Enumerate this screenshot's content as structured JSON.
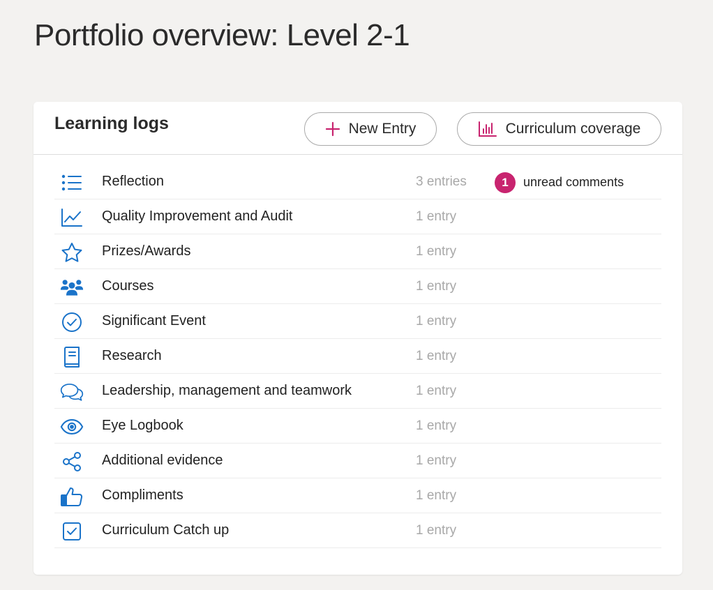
{
  "page": {
    "title": "Portfolio overview: Level 2-1"
  },
  "card": {
    "title": "Learning logs",
    "new_entry_label": "New Entry",
    "coverage_label": "Curriculum coverage"
  },
  "colors": {
    "icon_blue": "#1a73c9",
    "accent_magenta": "#c8246f",
    "muted_text": "#a8a8a8"
  },
  "logs": [
    {
      "name": "Reflection",
      "count": "3 entries",
      "icon": "list-icon",
      "badge": "1",
      "badge_label": "unread comments"
    },
    {
      "name": "Quality Improvement and Audit",
      "count": "1 entry",
      "icon": "line-chart-icon"
    },
    {
      "name": "Prizes/Awards",
      "count": "1 entry",
      "icon": "star-icon"
    },
    {
      "name": "Courses",
      "count": "1 entry",
      "icon": "people-icon"
    },
    {
      "name": "Significant Event",
      "count": "1 entry",
      "icon": "check-circle-icon"
    },
    {
      "name": "Research",
      "count": "1 entry",
      "icon": "book-icon"
    },
    {
      "name": "Leadership, management and teamwork",
      "count": "1 entry",
      "icon": "chat-bubbles-icon"
    },
    {
      "name": "Eye Logbook",
      "count": "1 entry",
      "icon": "eye-icon"
    },
    {
      "name": "Additional evidence",
      "count": "1 entry",
      "icon": "share-icon"
    },
    {
      "name": "Compliments",
      "count": "1 entry",
      "icon": "thumbs-up-icon"
    },
    {
      "name": "Curriculum Catch up",
      "count": "1 entry",
      "icon": "checkbox-icon"
    }
  ]
}
